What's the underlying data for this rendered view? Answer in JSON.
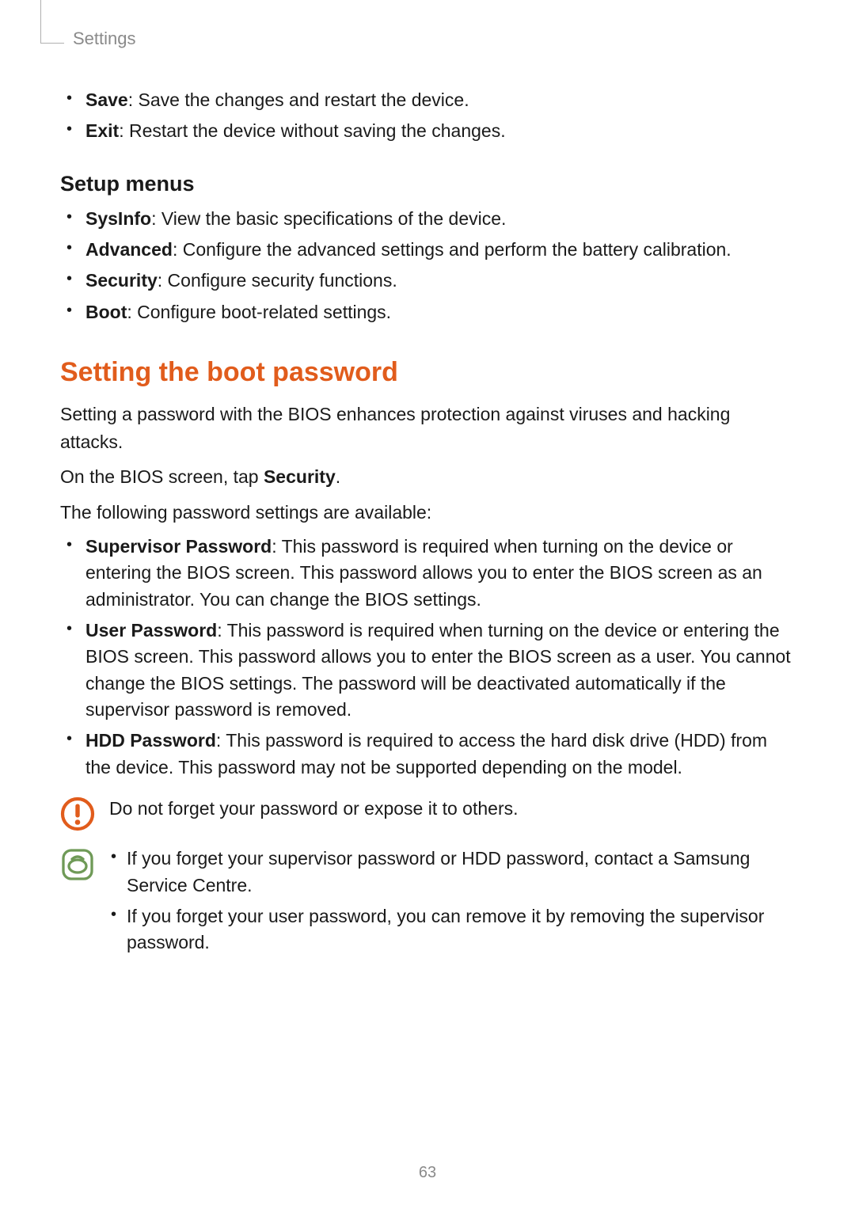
{
  "header": {
    "section": "Settings"
  },
  "top_list": [
    {
      "term": "Save",
      "desc": "Save the changes and restart the device."
    },
    {
      "term": "Exit",
      "desc": "Restart the device without saving the changes."
    }
  ],
  "setup_menus": {
    "heading": "Setup menus",
    "items": [
      {
        "term": "SysInfo",
        "desc": "View the basic specifications of the device."
      },
      {
        "term": "Advanced",
        "desc": "Configure the advanced settings and perform the battery calibration."
      },
      {
        "term": "Security",
        "desc": "Configure security functions."
      },
      {
        "term": "Boot",
        "desc": "Configure boot-related settings."
      }
    ]
  },
  "boot_password": {
    "heading": "Setting the boot password",
    "intro1": "Setting a password with the BIOS enhances protection against viruses and hacking attacks.",
    "intro2_prefix": "On the BIOS screen, tap ",
    "intro2_bold": "Security",
    "intro2_suffix": ".",
    "intro3": "The following password settings are available:",
    "items": [
      {
        "term": "Supervisor Password",
        "desc": "This password is required when turning on the device or entering the BIOS screen. This password allows you to enter the BIOS screen as an administrator. You can change the BIOS settings."
      },
      {
        "term": "User Password",
        "desc": "This password is required when turning on the device or entering the BIOS screen. This password allows you to enter the BIOS screen as a user. You cannot change the BIOS settings. The password will be deactivated automatically if the supervisor password is removed."
      },
      {
        "term": "HDD Password",
        "desc": "This password is required to access the hard disk drive (HDD) from the device. This password may not be supported depending on the model."
      }
    ],
    "caution": "Do not forget your password or expose it to others.",
    "notes": [
      "If you forget your supervisor password or HDD password, contact a Samsung Service Centre.",
      "If you forget your user password, you can remove it by removing the supervisor password."
    ]
  },
  "page_number": "63"
}
